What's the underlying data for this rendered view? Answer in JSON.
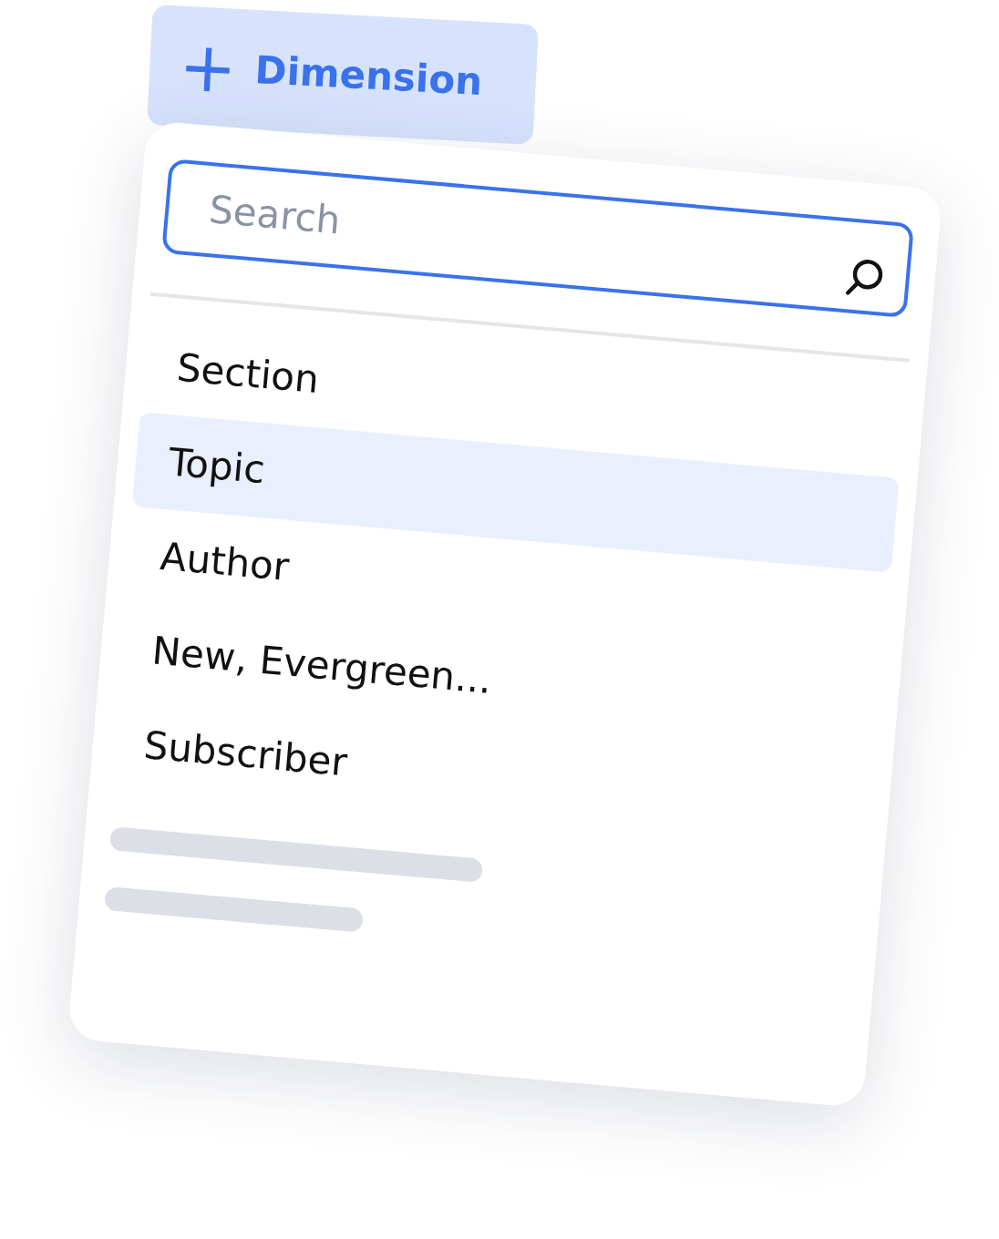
{
  "add_button": {
    "icon": "+",
    "label": "Dimension"
  },
  "search": {
    "placeholder": "Search"
  },
  "items": [
    {
      "label": "Section",
      "selected": false
    },
    {
      "label": "Topic",
      "selected": true
    },
    {
      "label": "Author",
      "selected": false
    },
    {
      "label": "New, Evergreen...",
      "selected": false
    },
    {
      "label": "Subscriber",
      "selected": false
    }
  ]
}
